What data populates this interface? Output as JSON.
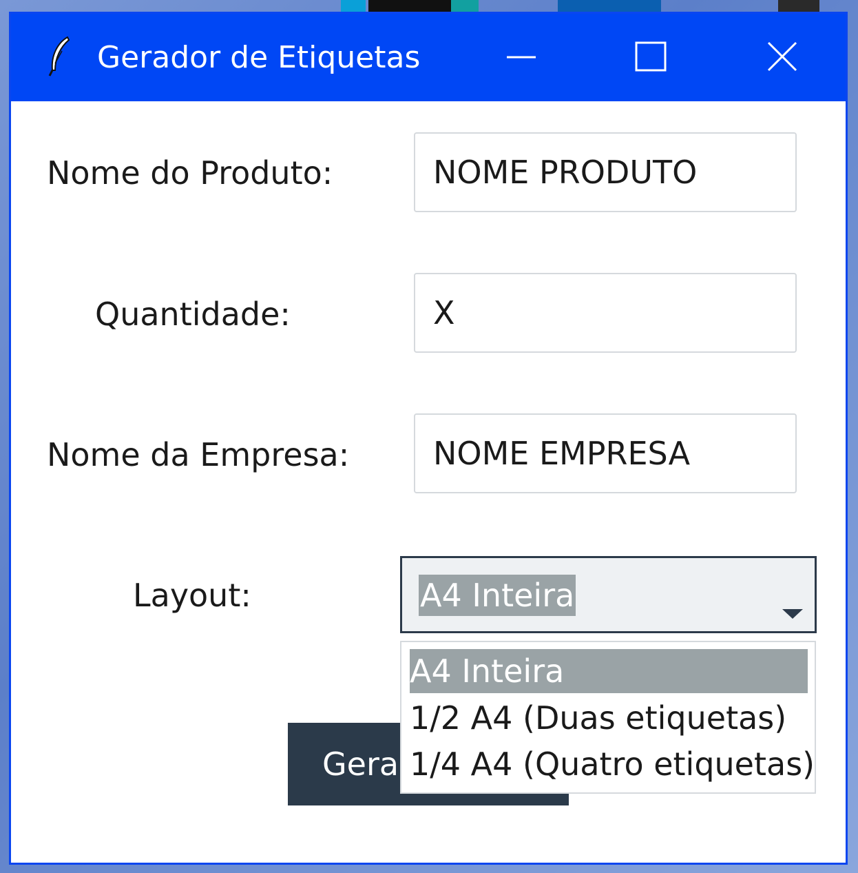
{
  "window": {
    "title": "Gerador de Etiquetas",
    "titlebar_color": "#0047f5",
    "icon": "feather-icon"
  },
  "titlebar_buttons": {
    "minimize": "minimize-icon",
    "maximize": "maximize-icon",
    "close": "close-icon"
  },
  "form": {
    "product_label": "Nome do Produto:",
    "product_value": "NOME PRODUTO",
    "quantity_label": "Quantidade:",
    "quantity_value": "X",
    "company_label": "Nome da Empresa:",
    "company_value": "NOME EMPRESA",
    "layout_label": "Layout:",
    "layout_selected": "A4 Inteira",
    "layout_options": [
      "A4 Inteira",
      "1/2 A4 (Duas etiquetas)",
      "1/4 A4 (Quatro etiquetas)"
    ],
    "generate_button_visible_text": "Gerar"
  },
  "colors": {
    "button_bg": "#2b3a4a",
    "selection_bg": "#9aa3a6"
  }
}
